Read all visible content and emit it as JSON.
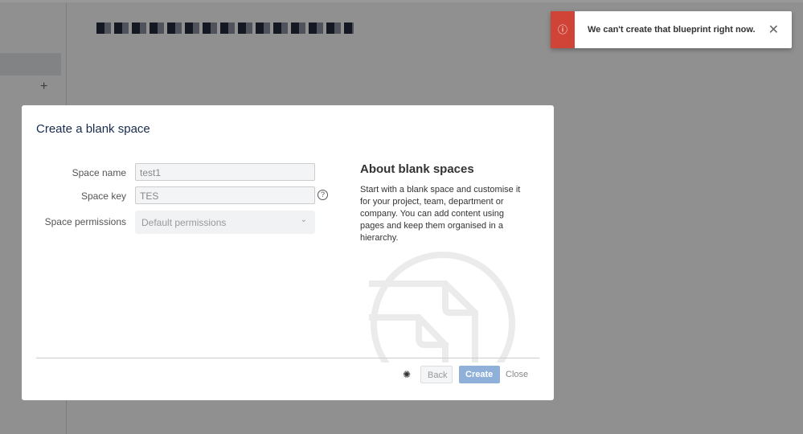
{
  "modal": {
    "title": "Create a blank space",
    "fields": [
      {
        "label": "Space name",
        "value": "test1"
      },
      {
        "label": "Space key",
        "value": "TES"
      },
      {
        "label": "Space permissions",
        "value": "Default permissions"
      }
    ],
    "about_title": "About blank spaces",
    "about_text": "Start with a blank space and customise it for your project, team, department or company. You can add content using pages and keep them organised in a hierarchy.",
    "back": "Back",
    "create": "Create",
    "close": "Close"
  },
  "toast": {
    "message": "We can't create that blueprint right now.",
    "color": "#d04437"
  }
}
